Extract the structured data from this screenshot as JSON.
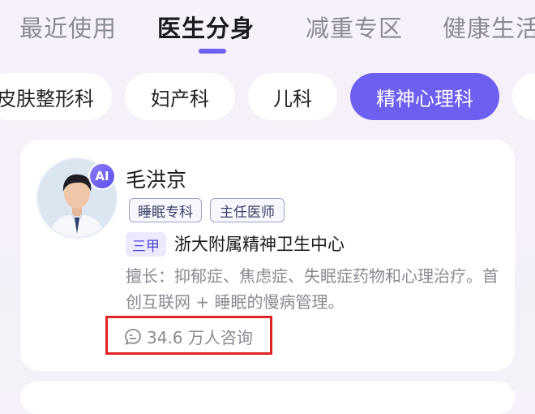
{
  "tabs": [
    {
      "label": "最近使用"
    },
    {
      "label": "医生分身"
    },
    {
      "label": "减重专区"
    },
    {
      "label": "健康生活"
    }
  ],
  "categories": [
    {
      "label": "皮肤整形科"
    },
    {
      "label": "妇产科"
    },
    {
      "label": "儿科"
    },
    {
      "label": "精神心理科"
    }
  ],
  "doctor": {
    "ai_badge": "AI",
    "name": "毛洪京",
    "tags": [
      "睡眠专科",
      "主任医师"
    ],
    "grade": "三甲",
    "hospital": "浙大附属精神卫生中心",
    "specialty": "擅长：抑郁症、焦虑症、失眠症药物和心理治疗。首创互联网 + 睡眠的慢病管理。",
    "consult_count": "34.6 万人咨询"
  },
  "colors": {
    "accent": "#6d5ff0",
    "highlight_box": "#e02424"
  }
}
